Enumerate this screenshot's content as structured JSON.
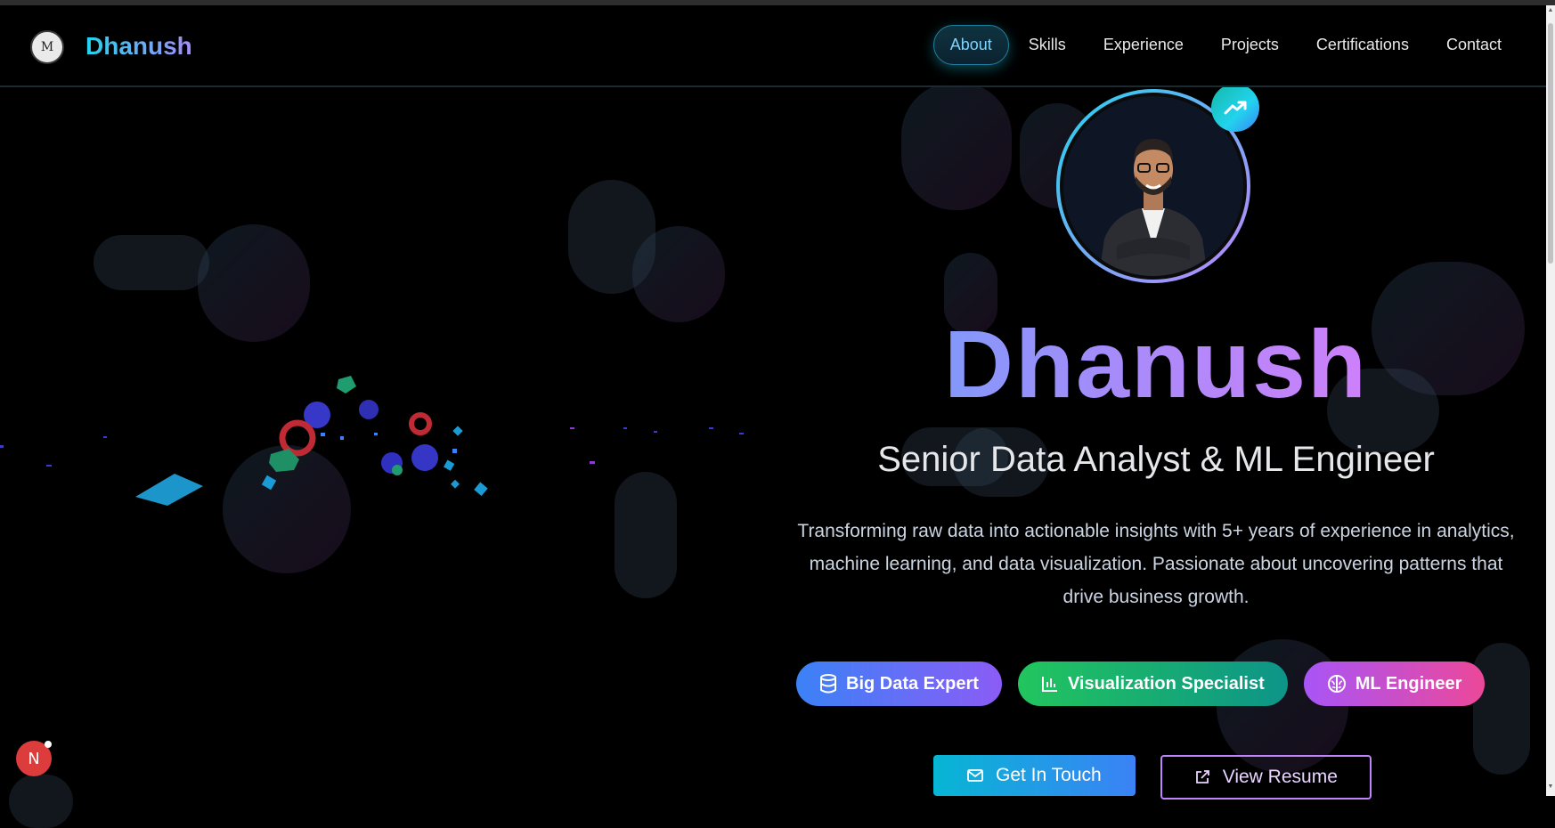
{
  "nav": {
    "logo_glyph": "M",
    "brand": "Dhanush",
    "items": [
      {
        "label": "About",
        "active": true
      },
      {
        "label": "Skills"
      },
      {
        "label": "Experience"
      },
      {
        "label": "Projects"
      },
      {
        "label": "Certifications"
      },
      {
        "label": "Contact"
      }
    ]
  },
  "hero": {
    "name": "Dhanush",
    "role": "Senior Data Analyst & ML Engineer",
    "description": "Transforming raw data into actionable insights with 5+ years of experience in analytics, machine learning, and data visualization. Passionate about uncovering patterns that drive business growth.",
    "badges": [
      {
        "label": "Big Data Expert",
        "icon": "database-icon"
      },
      {
        "label": "Visualization Specialist",
        "icon": "bar-chart-icon"
      },
      {
        "label": "ML Engineer",
        "icon": "brain-icon"
      }
    ],
    "cta_primary": "Get In Touch",
    "cta_secondary": "View Resume"
  },
  "notification": {
    "glyph": "N"
  },
  "colors": {
    "background": "#000000",
    "accent_cyan": "#22d3ee",
    "accent_purple": "#a78bfa",
    "accent_pink": "#e879f9",
    "badge_red": "#dc3c3c"
  }
}
